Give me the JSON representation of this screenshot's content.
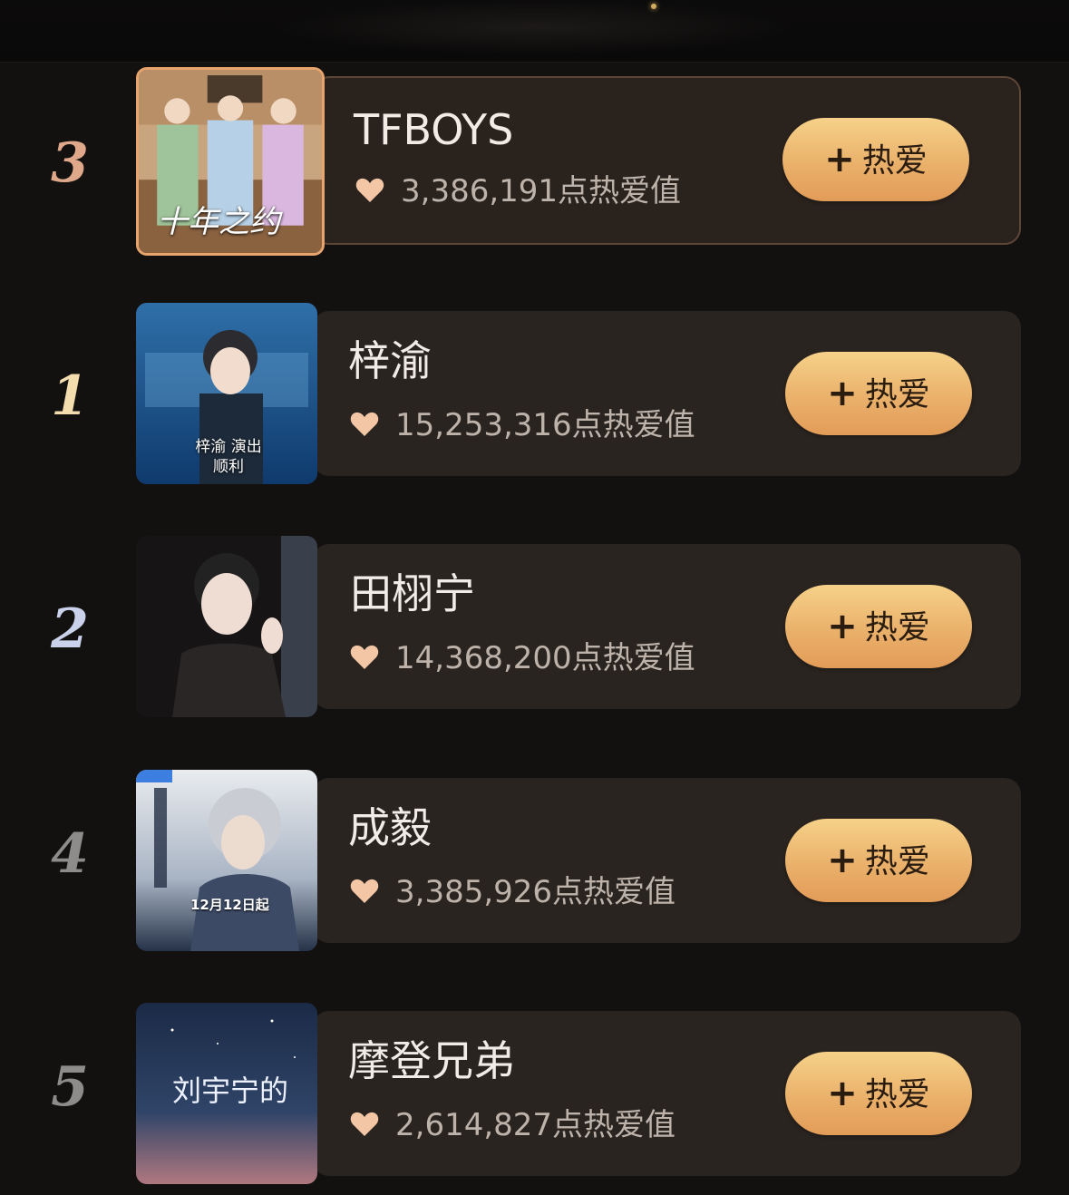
{
  "items": [
    {
      "rank": "3",
      "name": "TFBOYS",
      "score": "3,386,191点热爱值",
      "button": "热爱",
      "rank_color": "#e0a88a",
      "thumb_caption": "十年之约"
    },
    {
      "rank": "1",
      "name": "梓渝",
      "score": "15,253,316点热爱值",
      "button": "热爱",
      "rank_color": "#f3dcae",
      "thumb_caption": "梓渝 演出顺利"
    },
    {
      "rank": "2",
      "name": "田栩宁",
      "score": "14,368,200点热爱值",
      "button": "热爱",
      "rank_color": "#c9d2ea",
      "thumb_caption": ""
    },
    {
      "rank": "4",
      "name": "成毅",
      "score": "3,385,926点热爱值",
      "button": "热爱",
      "rank_color": "#8d8c8b",
      "thumb_caption": "12月12日起"
    },
    {
      "rank": "5",
      "name": "摩登兄弟",
      "score": "2,614,827点热爱值",
      "button": "热爱",
      "rank_color": "#8d8c8b",
      "thumb_caption": "刘宇宁的"
    }
  ],
  "button_plus": "+",
  "icons": {
    "heart": "heart-icon",
    "plus": "plus-icon"
  },
  "colors": {
    "button_gold": "#eab16b",
    "card_bg": "#2a2420",
    "heart": "#f3c7a6"
  }
}
